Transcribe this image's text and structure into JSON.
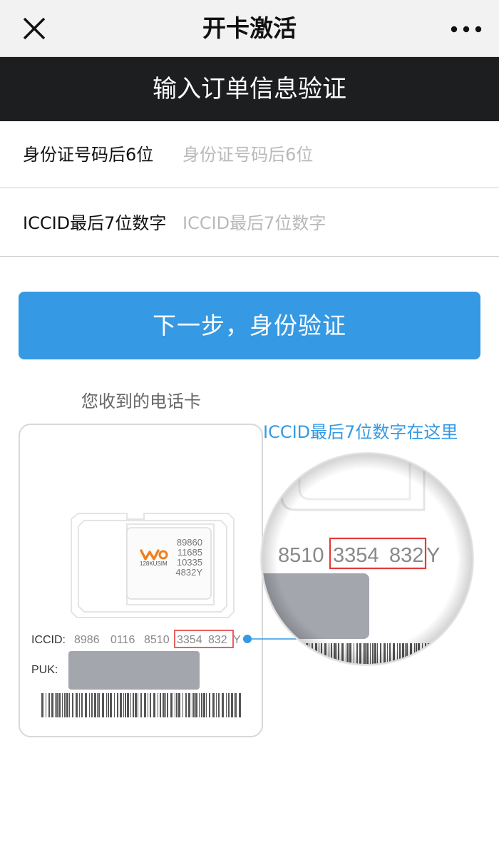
{
  "header": {
    "title": "开卡激活",
    "close_icon": "close-icon",
    "more_icon": "more-dots-icon"
  },
  "banner": {
    "text": "输入订单信息验证"
  },
  "form": {
    "id_label": "身份证号码后6位",
    "id_placeholder": "身份证号码后6位",
    "iccid_label": "ICCID最后7位数字",
    "iccid_placeholder": "ICCID最后7位数字"
  },
  "next_button": {
    "label": "下一步，身份验证"
  },
  "illustration": {
    "caption": "您收到的电话卡",
    "hint": "ICCID最后7位数字在这里",
    "accent_color": "#3599e3",
    "highlight_color": "#e23a3a",
    "sim": {
      "brand_logo": "wo-logo",
      "model": "128KUSIM",
      "numbers": [
        "89860",
        "11685",
        "10335",
        "4832Y"
      ]
    },
    "iccid_label": "ICCID:",
    "iccid_groups": [
      "8986",
      "0116",
      "8510"
    ],
    "iccid_highlight_a": "3354",
    "iccid_highlight_b": "832",
    "iccid_suffix": "Y",
    "puk_label": "PUK:",
    "zoom": {
      "prefix": "8510",
      "highlight_a": "3354",
      "highlight_b": "832",
      "suffix": "Y"
    }
  }
}
